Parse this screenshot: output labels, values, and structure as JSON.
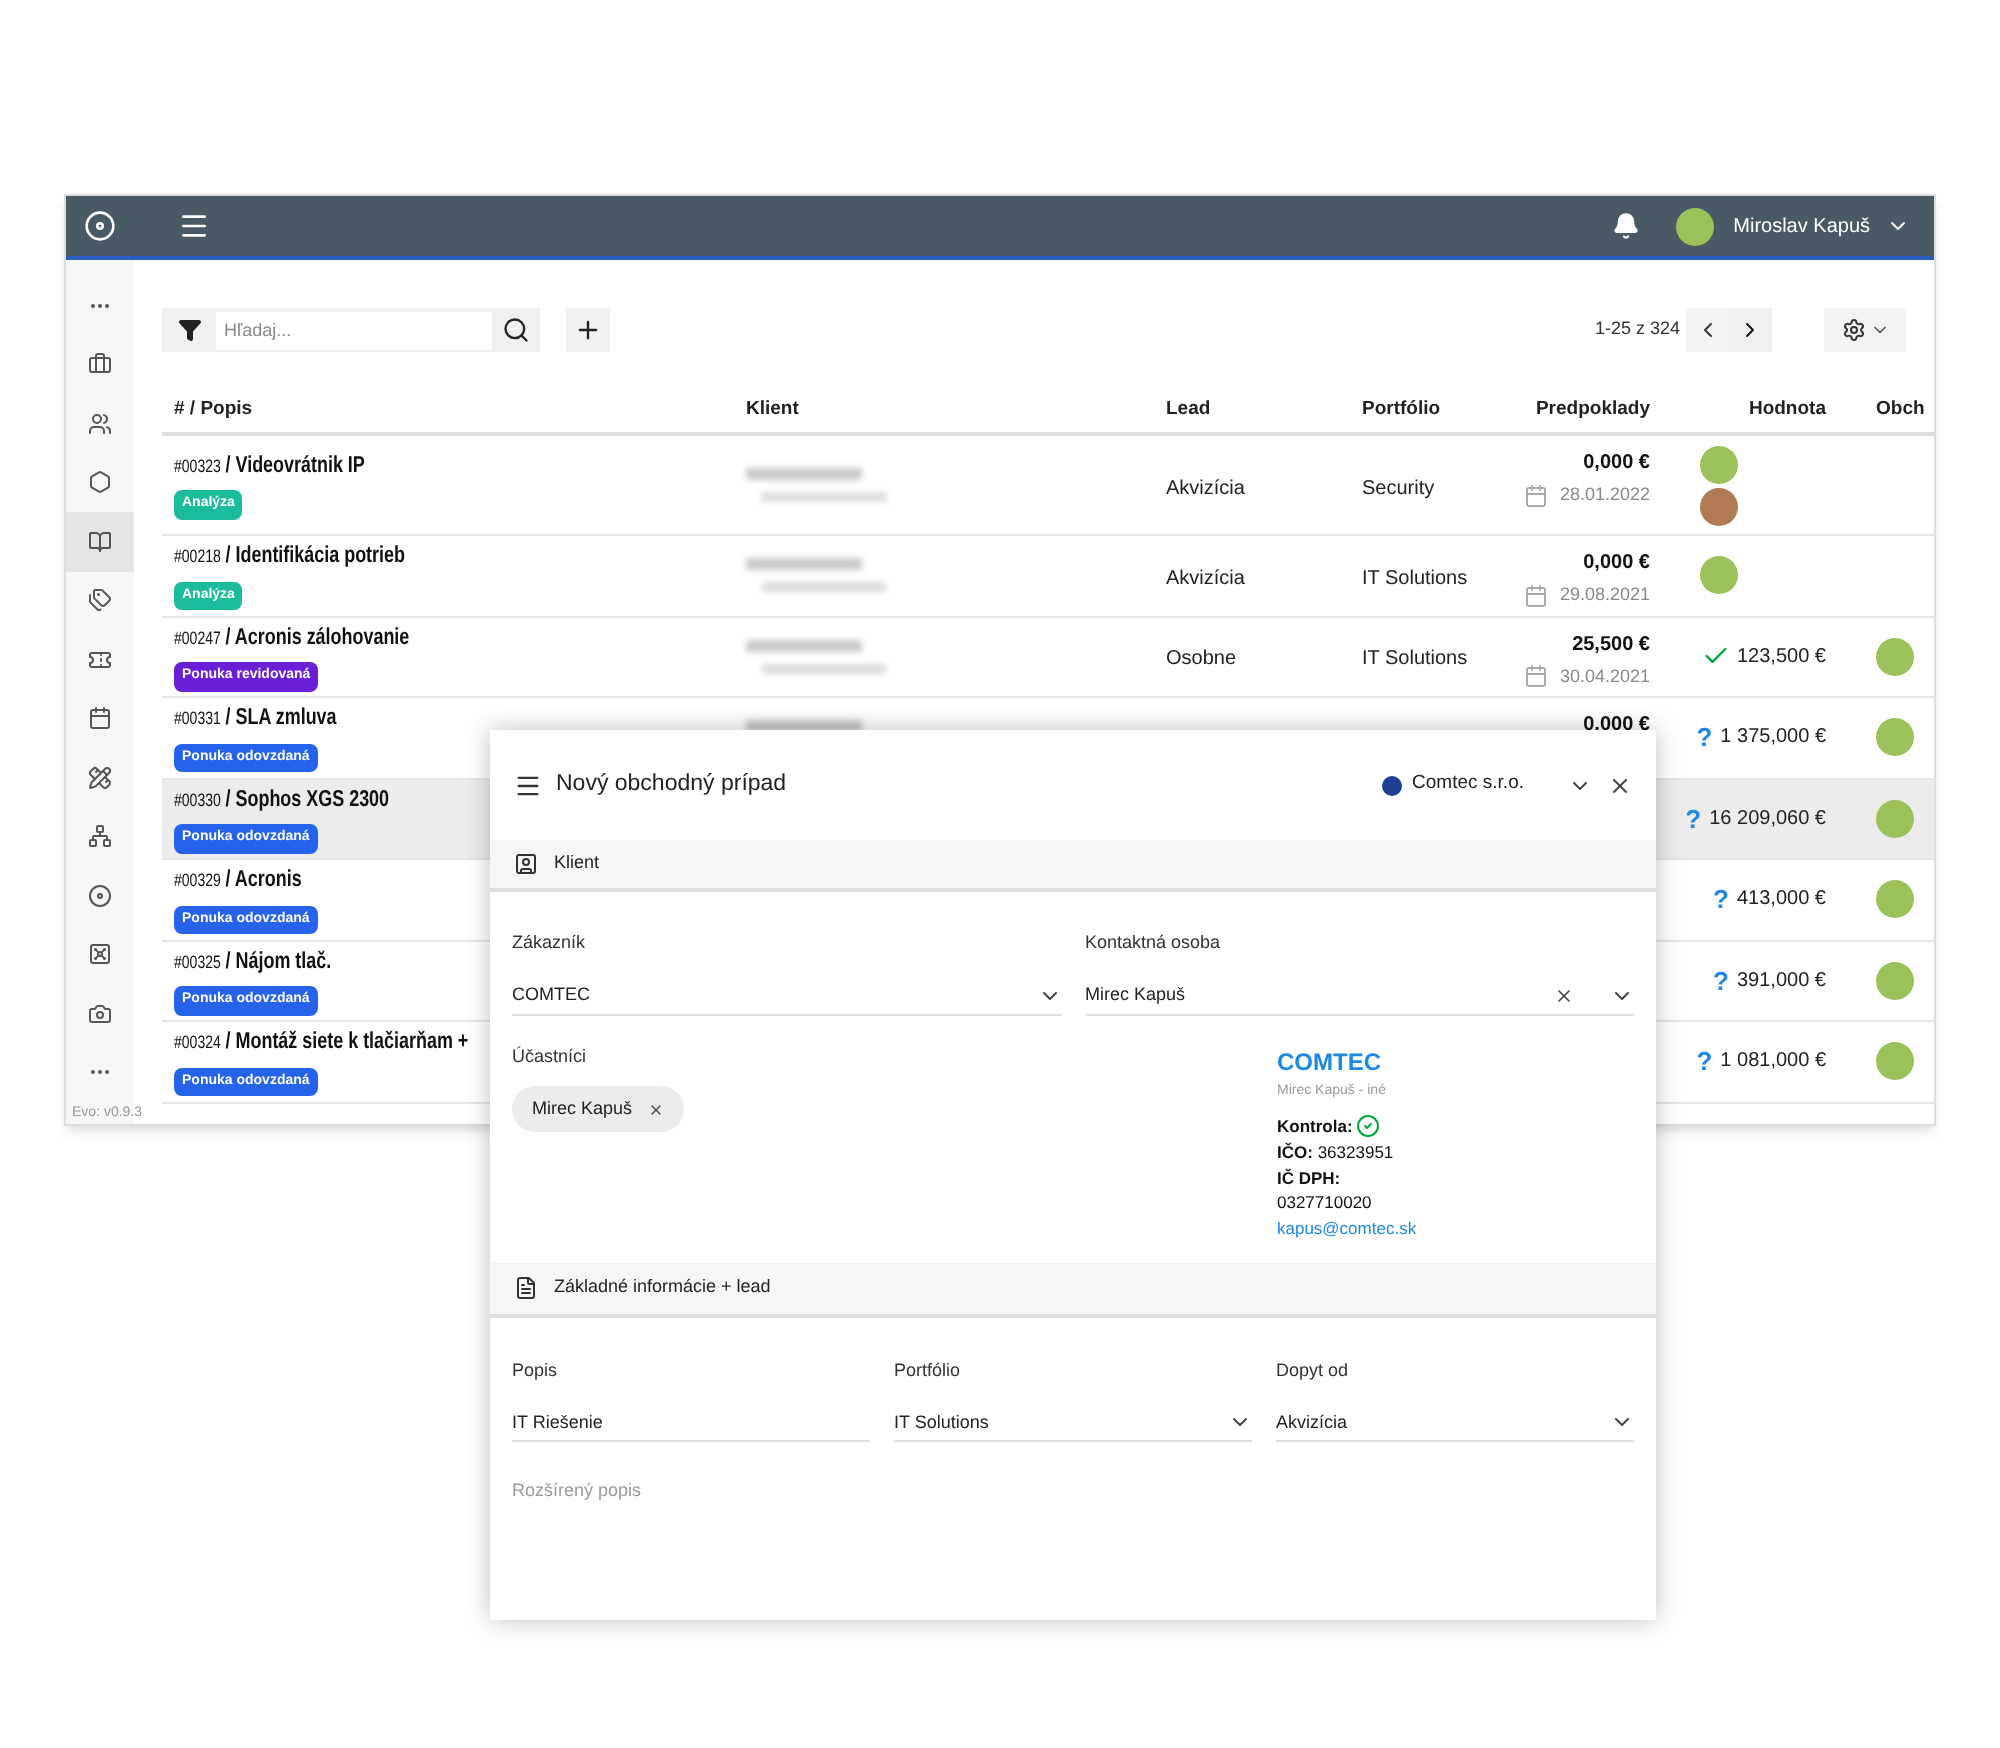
{
  "topbar": {
    "user": "Miroslav Kapuš"
  },
  "sidebar": {
    "items": [
      {
        "selected": false
      },
      {
        "selected": false
      },
      {
        "selected": false
      },
      {
        "selected": false
      },
      {
        "selected": true
      },
      {
        "selected": false
      },
      {
        "selected": false
      },
      {
        "selected": false
      },
      {
        "selected": false
      },
      {
        "selected": false
      },
      {
        "selected": false
      },
      {
        "selected": false
      },
      {
        "selected": false
      },
      {
        "selected": false
      }
    ],
    "version": "Evo: v0.9.3"
  },
  "toolbar": {
    "search": {
      "placeholder": "Hľadaj..."
    },
    "pagination": "1-25 z 324"
  },
  "table": {
    "columns": [
      "# / Popis",
      "Klient",
      "Lead",
      "Portfólio",
      "Predpoklady",
      "Hodnota",
      "Obch"
    ],
    "rows": [
      {
        "id": "#00323",
        "title": "/ Videovrátnik IP",
        "tag": {
          "label": "Analýza",
          "color": "#1abc9c"
        },
        "lead": "Akvizícia",
        "portfolio": "Security",
        "amount": "0,000 €",
        "date": "28.01.2022",
        "value": {
          "kind": "none"
        },
        "avatars": [
          {
            "kind": "photo"
          },
          {
            "kind": "photo"
          }
        ],
        "selected": false
      },
      {
        "id": "#00218",
        "title": "/ Identifikácia potrieb",
        "tag": {
          "label": "Analýza",
          "color": "#1abc9c"
        },
        "lead": "Akvizícia",
        "portfolio": "IT Solutions",
        "amount": "0,000 €",
        "date": "29.08.2021",
        "value": {
          "kind": "none"
        },
        "avatars": [
          {
            "kind": "photo"
          }
        ],
        "selected": false
      },
      {
        "id": "#00247",
        "title": "/ Acronis zálohovanie",
        "tag": {
          "label": "Ponuka revidovaná",
          "color": "#6a1fd6"
        },
        "lead": "Osobne",
        "portfolio": "IT Solutions",
        "amount": "25,500 €",
        "date": "30.04.2021",
        "value": {
          "kind": "confirmed",
          "text": "123,500 €"
        },
        "avatars": [
          {
            "kind": "photo"
          }
        ],
        "selected": false
      },
      {
        "id": "#00331",
        "title": "/ SLA zmluva",
        "tag": {
          "label": "Ponuka odovzdaná",
          "color": "#2563eb"
        },
        "amount": "0,000 €",
        "value": {
          "kind": "unconfirmed",
          "mark": "?",
          "text": "1 375,000 €"
        },
        "avatars": [
          {
            "kind": "photo"
          }
        ],
        "selected": false
      },
      {
        "id": "#00330",
        "title": "/ Sophos XGS 2300",
        "tag": {
          "label": "Ponuka odovzdaná",
          "color": "#2563eb"
        },
        "value": {
          "kind": "unconfirmed",
          "mark": "?",
          "text": "16 209,060 €"
        },
        "avatars": [
          {
            "kind": "photo"
          }
        ],
        "selected": true
      },
      {
        "id": "#00329",
        "title": "/ Acronis",
        "tag": {
          "label": "Ponuka odovzdaná",
          "color": "#2563eb"
        },
        "value": {
          "kind": "unconfirmed",
          "mark": "?",
          "text": "413,000 €"
        },
        "avatars": [
          {
            "kind": "photo"
          }
        ],
        "selected": false
      },
      {
        "id": "#00325",
        "title": "/ Nájom tlač.",
        "tag": {
          "label": "Ponuka odovzdaná",
          "color": "#2563eb"
        },
        "value": {
          "kind": "unconfirmed",
          "mark": "?",
          "text": "391,000 €"
        },
        "avatars": [
          {
            "kind": "photo"
          }
        ],
        "selected": false
      },
      {
        "id": "#00324",
        "title": "/ Montáž siete k tlačiarňam +",
        "tag": {
          "label": "Ponuka odovzdaná",
          "color": "#2563eb"
        },
        "value": {
          "kind": "unconfirmed",
          "mark": "?",
          "text": "1 081,000 €"
        },
        "avatars": [
          {
            "kind": "photo"
          }
        ],
        "selected": false
      }
    ]
  },
  "modal": {
    "title": "Nový obchodný prípad",
    "company": {
      "name": "Comtec s.r.o.",
      "color": "#1e3f94"
    },
    "sections": [
      {
        "kind": "client",
        "title": "Klient",
        "customer": {
          "label": "Zákazník",
          "value": "COMTEC"
        },
        "contact": {
          "label": "Kontaktná osoba",
          "value": "Mirec Kapuš"
        },
        "participants": {
          "label": "Účastníci",
          "chips": [
            "Mirec Kapuš"
          ]
        },
        "info": {
          "name": "COMTEC",
          "subtitle": "Mirec Kapuš - iné",
          "check_label": "Kontrola:",
          "check_ok": true,
          "ico_label": "IČO:",
          "ico": "36323951",
          "dic_label": "IČ DPH:",
          "dic": "0327710020",
          "email": "kapus@comtec.sk"
        }
      },
      {
        "kind": "basic",
        "title": "Základné informácie + lead",
        "fields": [
          {
            "kind": "text",
            "label": "Popis",
            "value": "IT Riešenie"
          },
          {
            "kind": "select",
            "label": "Portfólio",
            "value": "IT Solutions"
          },
          {
            "kind": "select",
            "label": "Dopyt od",
            "value": "Akvizícia"
          }
        ],
        "extended": {
          "placeholder": "Rozšírený popis"
        }
      }
    ]
  }
}
